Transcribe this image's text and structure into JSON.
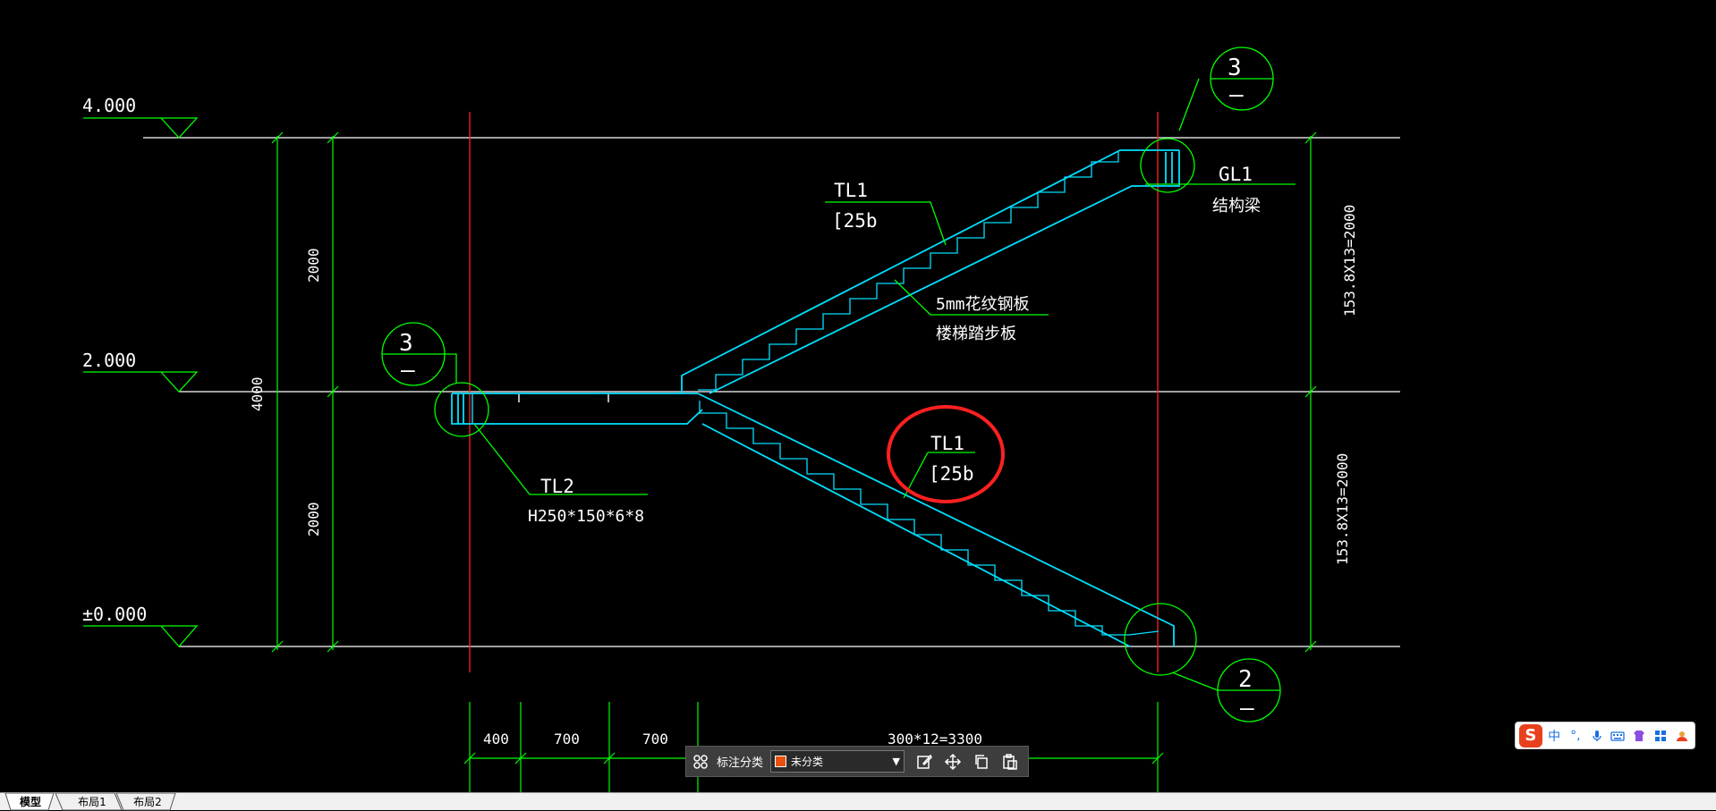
{
  "drawing": {
    "levels": [
      "4.000",
      "2.000",
      "±0.000"
    ],
    "vertical_dims": {
      "outer_total": "4000",
      "upper_half": "2000",
      "lower_half": "2000"
    },
    "right_dims": {
      "upper": "153.8X13=2000",
      "lower": "153.8X13=2000"
    },
    "bottom_dims": [
      "400",
      "700",
      "700",
      "300*12=3300"
    ],
    "callouts": {
      "tl1_upper": {
        "name": "TL1",
        "section": "[25b"
      },
      "tl1_lower": {
        "name": "TL1",
        "section": "[25b"
      },
      "gl1": {
        "name": "GL1",
        "desc": "结构梁"
      },
      "plate": {
        "line1": "5mm花纹钢板",
        "line2": "楼梯踏步板"
      },
      "tl2": {
        "name": "TL2",
        "section": "H250*150*6*8"
      }
    },
    "detail_markers": {
      "top_right": "3",
      "left": "3",
      "bottom_right": "2"
    }
  },
  "toolbar": {
    "label": "标注分类",
    "category_value": "未分类",
    "category_color": "#e8500e"
  },
  "ime": {
    "logo": "S",
    "lang": "中",
    "punct": "°,"
  },
  "tabs": [
    "模型",
    "布局1",
    "布局2"
  ],
  "colors": {
    "background": "#000000",
    "green": "#00ff00",
    "cyan": "#00e0ff",
    "red": "#ff2020",
    "white": "#ffffff"
  }
}
